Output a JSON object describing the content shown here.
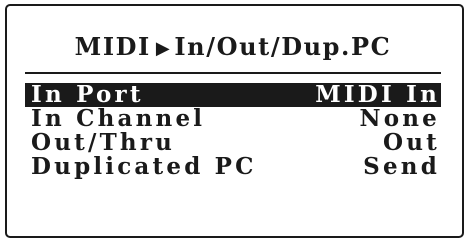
{
  "screen": {
    "title_prefix": "MIDI",
    "breadcrumb_arrow": "▶",
    "title_page": "In/Out/Dup.PC"
  },
  "params": [
    {
      "label": "In Port",
      "value": "MIDI In",
      "selected": true
    },
    {
      "label": "In Channel",
      "value": "None",
      "selected": false
    },
    {
      "label": "Out/Thru",
      "value": "Out",
      "selected": false
    },
    {
      "label": "Duplicated PC",
      "value": "Send",
      "selected": false
    }
  ]
}
